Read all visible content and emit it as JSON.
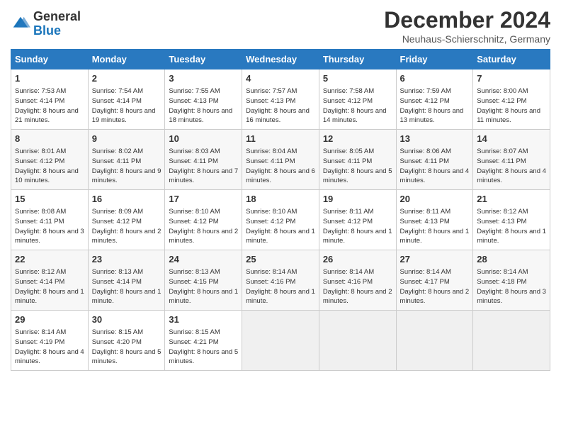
{
  "header": {
    "logo_line1": "General",
    "logo_line2": "Blue",
    "month_title": "December 2024",
    "location": "Neuhaus-Schierschnitz, Germany"
  },
  "days_of_week": [
    "Sunday",
    "Monday",
    "Tuesday",
    "Wednesday",
    "Thursday",
    "Friday",
    "Saturday"
  ],
  "weeks": [
    [
      {
        "day": "1",
        "sunrise": "7:53 AM",
        "sunset": "4:14 PM",
        "daylight": "8 hours and 21 minutes."
      },
      {
        "day": "2",
        "sunrise": "7:54 AM",
        "sunset": "4:14 PM",
        "daylight": "8 hours and 19 minutes."
      },
      {
        "day": "3",
        "sunrise": "7:55 AM",
        "sunset": "4:13 PM",
        "daylight": "8 hours and 18 minutes."
      },
      {
        "day": "4",
        "sunrise": "7:57 AM",
        "sunset": "4:13 PM",
        "daylight": "8 hours and 16 minutes."
      },
      {
        "day": "5",
        "sunrise": "7:58 AM",
        "sunset": "4:12 PM",
        "daylight": "8 hours and 14 minutes."
      },
      {
        "day": "6",
        "sunrise": "7:59 AM",
        "sunset": "4:12 PM",
        "daylight": "8 hours and 13 minutes."
      },
      {
        "day": "7",
        "sunrise": "8:00 AM",
        "sunset": "4:12 PM",
        "daylight": "8 hours and 11 minutes."
      }
    ],
    [
      {
        "day": "8",
        "sunrise": "8:01 AM",
        "sunset": "4:12 PM",
        "daylight": "8 hours and 10 minutes."
      },
      {
        "day": "9",
        "sunrise": "8:02 AM",
        "sunset": "4:11 PM",
        "daylight": "8 hours and 9 minutes."
      },
      {
        "day": "10",
        "sunrise": "8:03 AM",
        "sunset": "4:11 PM",
        "daylight": "8 hours and 7 minutes."
      },
      {
        "day": "11",
        "sunrise": "8:04 AM",
        "sunset": "4:11 PM",
        "daylight": "8 hours and 6 minutes."
      },
      {
        "day": "12",
        "sunrise": "8:05 AM",
        "sunset": "4:11 PM",
        "daylight": "8 hours and 5 minutes."
      },
      {
        "day": "13",
        "sunrise": "8:06 AM",
        "sunset": "4:11 PM",
        "daylight": "8 hours and 4 minutes."
      },
      {
        "day": "14",
        "sunrise": "8:07 AM",
        "sunset": "4:11 PM",
        "daylight": "8 hours and 4 minutes."
      }
    ],
    [
      {
        "day": "15",
        "sunrise": "8:08 AM",
        "sunset": "4:11 PM",
        "daylight": "8 hours and 3 minutes."
      },
      {
        "day": "16",
        "sunrise": "8:09 AM",
        "sunset": "4:12 PM",
        "daylight": "8 hours and 2 minutes."
      },
      {
        "day": "17",
        "sunrise": "8:10 AM",
        "sunset": "4:12 PM",
        "daylight": "8 hours and 2 minutes."
      },
      {
        "day": "18",
        "sunrise": "8:10 AM",
        "sunset": "4:12 PM",
        "daylight": "8 hours and 1 minute."
      },
      {
        "day": "19",
        "sunrise": "8:11 AM",
        "sunset": "4:12 PM",
        "daylight": "8 hours and 1 minute."
      },
      {
        "day": "20",
        "sunrise": "8:11 AM",
        "sunset": "4:13 PM",
        "daylight": "8 hours and 1 minute."
      },
      {
        "day": "21",
        "sunrise": "8:12 AM",
        "sunset": "4:13 PM",
        "daylight": "8 hours and 1 minute."
      }
    ],
    [
      {
        "day": "22",
        "sunrise": "8:12 AM",
        "sunset": "4:14 PM",
        "daylight": "8 hours and 1 minute."
      },
      {
        "day": "23",
        "sunrise": "8:13 AM",
        "sunset": "4:14 PM",
        "daylight": "8 hours and 1 minute."
      },
      {
        "day": "24",
        "sunrise": "8:13 AM",
        "sunset": "4:15 PM",
        "daylight": "8 hours and 1 minute."
      },
      {
        "day": "25",
        "sunrise": "8:14 AM",
        "sunset": "4:16 PM",
        "daylight": "8 hours and 1 minute."
      },
      {
        "day": "26",
        "sunrise": "8:14 AM",
        "sunset": "4:16 PM",
        "daylight": "8 hours and 2 minutes."
      },
      {
        "day": "27",
        "sunrise": "8:14 AM",
        "sunset": "4:17 PM",
        "daylight": "8 hours and 2 minutes."
      },
      {
        "day": "28",
        "sunrise": "8:14 AM",
        "sunset": "4:18 PM",
        "daylight": "8 hours and 3 minutes."
      }
    ],
    [
      {
        "day": "29",
        "sunrise": "8:14 AM",
        "sunset": "4:19 PM",
        "daylight": "8 hours and 4 minutes."
      },
      {
        "day": "30",
        "sunrise": "8:15 AM",
        "sunset": "4:20 PM",
        "daylight": "8 hours and 5 minutes."
      },
      {
        "day": "31",
        "sunrise": "8:15 AM",
        "sunset": "4:21 PM",
        "daylight": "8 hours and 5 minutes."
      },
      null,
      null,
      null,
      null
    ]
  ],
  "labels": {
    "sunrise": "Sunrise:",
    "sunset": "Sunset:",
    "daylight": "Daylight:"
  }
}
